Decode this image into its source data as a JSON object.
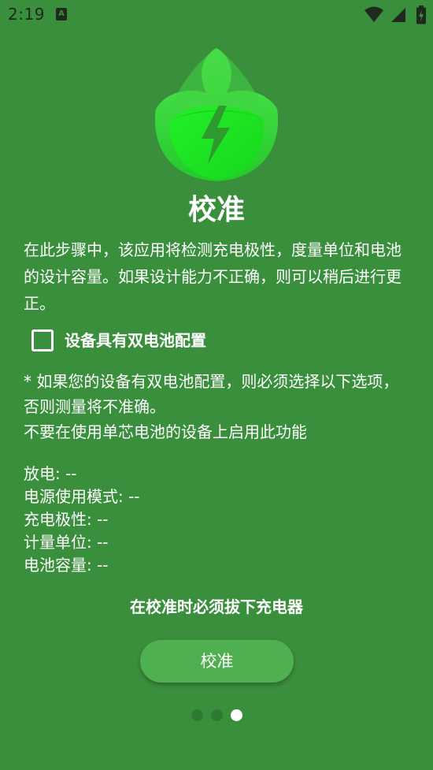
{
  "status_bar": {
    "time": "2:19",
    "notification_icon": "A",
    "icons": [
      "wifi-icon",
      "cellular-signal-icon",
      "battery-charging-icon"
    ]
  },
  "logo": {
    "icon": "leaf-lightning-bolt-logo",
    "colors": {
      "leaf_light": "#4de24d",
      "leaf_mid": "#2bd82f",
      "leaf_bright": "#19f220",
      "bolt": "#2f9b2f"
    }
  },
  "page": {
    "title": "校准",
    "description": "在此步骤中，该应用将检测充电极性，度量单位和电池的设计容量。如果设计能力不正确，则可以稍后进行更正。"
  },
  "dual_battery": {
    "label": "设备具有双电池配置",
    "checked": false
  },
  "warning": {
    "line1": "* 如果您的设备有双电池配置，则必须选择以下选项，否则测量将不准确。",
    "line2": "不要在使用单芯电池的设备上启用此功能"
  },
  "info": [
    {
      "label": "放电: --"
    },
    {
      "label": "电源使用模式: --"
    },
    {
      "label": "充电极性: --"
    },
    {
      "label": "计量单位: --"
    },
    {
      "label": "电池容量: --"
    }
  ],
  "unplug_note": "在校准时必须拔下充电器",
  "calibrate_button": "校准",
  "pagination": {
    "total": 3,
    "current": 3
  },
  "colors": {
    "background": "#3a8f3c",
    "button": "#4fb052",
    "dot_inactive": "#2f7a32",
    "dot_active": "#ffffff"
  }
}
